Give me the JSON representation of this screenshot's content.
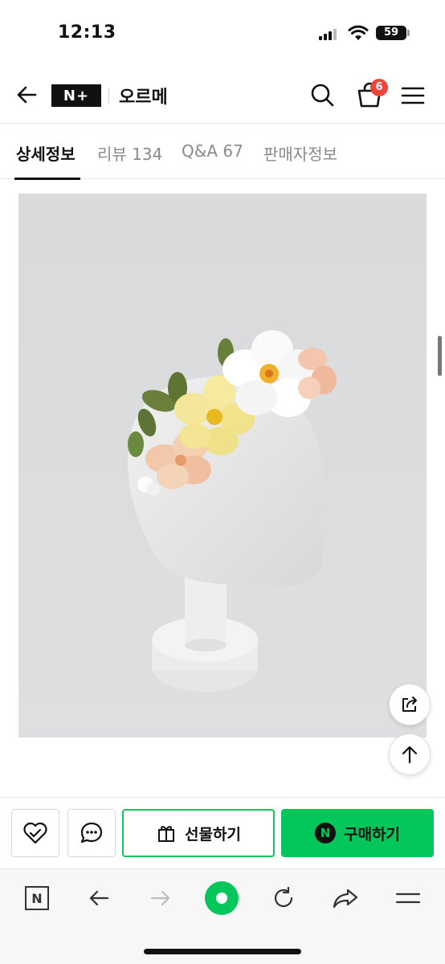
{
  "status": {
    "time": "12:13",
    "battery": "59"
  },
  "header": {
    "brand": "N+",
    "store_name": "오르메",
    "cart_count": "6"
  },
  "tabs": [
    {
      "label": "상세정보",
      "active": true
    },
    {
      "label": "리뷰 134",
      "active": false
    },
    {
      "label": "Q&A 67",
      "active": false
    },
    {
      "label": "판매자정보",
      "active": false
    }
  ],
  "product_image": {
    "alt": "paper-flower-headband-on-mannequin"
  },
  "purchase_bar": {
    "gift_label": "선물하기",
    "buy_label": "구매하기",
    "buy_badge": "N"
  },
  "browser_bar": {
    "home_label": "N"
  },
  "colors": {
    "accent_green": "#03c75a",
    "badge_red": "#f0433a"
  },
  "icons": [
    "back-arrow-icon",
    "search-icon",
    "shopping-bag-icon",
    "hamburger-menu-icon",
    "share-icon",
    "arrow-up-icon",
    "heart-check-icon",
    "chat-bubble-icon",
    "gift-icon",
    "naver-n-icon",
    "arrow-left-icon",
    "arrow-right-icon",
    "refresh-icon",
    "forward-share-icon"
  ]
}
